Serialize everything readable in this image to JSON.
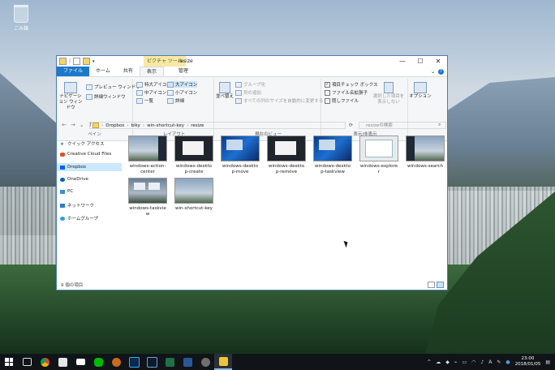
{
  "desktop": {
    "recycle_label": "ごみ箱"
  },
  "window": {
    "context_tool": "ピクチャ ツール",
    "title": "resize",
    "caption_min": "—",
    "caption_max": "☐",
    "caption_close": "✕"
  },
  "tabs": {
    "file": "ファイル",
    "home": "ホーム",
    "share": "共有",
    "view": "表示",
    "manage": "管理",
    "help": "?"
  },
  "ribbon": {
    "nav_pane": "ナビゲーション ウィンドウ",
    "preview_pane": "プレビュー ウィンドウ",
    "details_pane": "詳細ウィンドウ",
    "panes_label": "ペイン",
    "xl_icons": "特大アイコン",
    "large_icons": "大アイコン",
    "medium_icons": "中アイコン",
    "small_icons": "小アイコン",
    "list": "一覧",
    "details": "詳細",
    "layout_label": "レイアウト",
    "sort_by": "並べ替え",
    "group_by": "グループ化",
    "add_columns": "列の追加",
    "fit_columns": "すべての列のサイズを自動的に変更する",
    "current_view_label": "現在のビュー",
    "item_checkboxes": "項目チェック ボックス",
    "file_extensions": "ファイル名拡張子",
    "hidden_items": "隠しファイル",
    "hide_selected": "選択した項目を表示しない",
    "show_hide_label": "表示/非表示",
    "options": "オプション"
  },
  "address": {
    "back": "←",
    "forward": "→",
    "recent": "⌄",
    "up": "↑",
    "crumbs": [
      "Dropbox",
      "blky",
      "win-shortcut-key",
      "resize"
    ],
    "refresh": "⟳",
    "search_placeholder": "resizeの検索"
  },
  "nav": {
    "quick": "クイック アクセス",
    "cc": "Creative Cloud Files",
    "dropbox": "Dropbox",
    "onedrive": "OneDrive",
    "pc": "PC",
    "network": "ネットワーク",
    "homegroup": "ホームグループ"
  },
  "files": [
    {
      "name": "windows-action-center",
      "label": "windows-action-\ncenter"
    },
    {
      "name": "windows-desktop-create",
      "label": "windows-deskto\np-create"
    },
    {
      "name": "windows-desktop-move",
      "label": "windows-deskto\np-move"
    },
    {
      "name": "windows-desktop-remove",
      "label": "windows-deskto\np-remove"
    },
    {
      "name": "windows-desktop-taskview",
      "label": "windows-deskto\np-taskview"
    },
    {
      "name": "windows-explorer",
      "label": "windows-explore\nr"
    },
    {
      "name": "windows-search",
      "label": "windows-search"
    },
    {
      "name": "windows-taskview",
      "label": "windows-taskvie\nw"
    },
    {
      "name": "win-shortcut-key",
      "label": "win-shortcut-key"
    }
  ],
  "status": {
    "count": "9 個の項目"
  },
  "taskbar": {
    "time": "23:00",
    "date": "2018/01/05",
    "ime": "A"
  },
  "colors": {
    "accent": "#1979ca",
    "selection": "#cce4f7"
  }
}
